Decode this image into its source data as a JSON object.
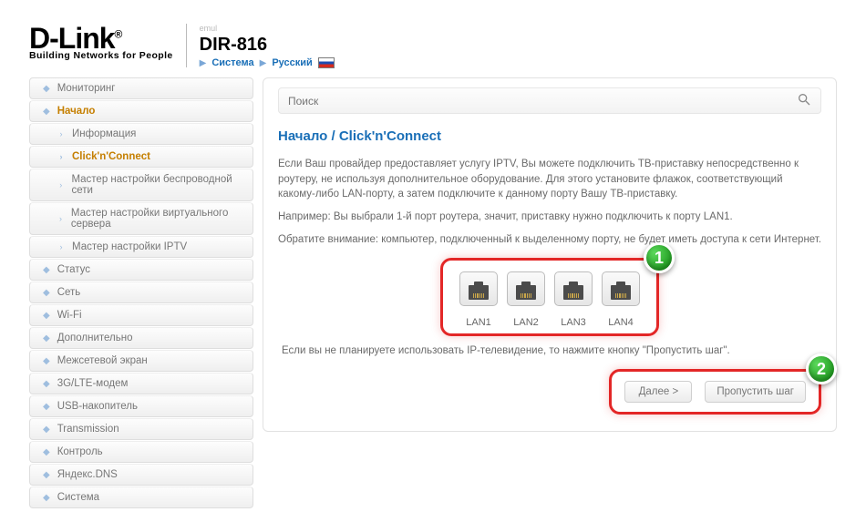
{
  "brand": {
    "title": "D-Link",
    "reg": "®",
    "tag": "Building Networks for People"
  },
  "header": {
    "emul": "emul",
    "model": "DIR-816",
    "link_system": "Система",
    "link_lang": "Русский"
  },
  "sidebar": {
    "items": [
      {
        "label": "Мониторинг"
      },
      {
        "label": "Начало"
      },
      {
        "label": "Статус"
      },
      {
        "label": "Сеть"
      },
      {
        "label": "Wi-Fi"
      },
      {
        "label": "Дополнительно"
      },
      {
        "label": "Межсетевой экран"
      },
      {
        "label": "3G/LTE-модем"
      },
      {
        "label": "USB-накопитель"
      },
      {
        "label": "Transmission"
      },
      {
        "label": "Контроль"
      },
      {
        "label": "Яндекс.DNS"
      },
      {
        "label": "Система"
      }
    ],
    "sub": [
      {
        "label": "Информация"
      },
      {
        "label": "Click'n'Connect"
      },
      {
        "label": "Мастер настройки беспроводной сети"
      },
      {
        "label": "Мастер настройки виртуального сервера"
      },
      {
        "label": "Мастер настройки IPTV"
      }
    ]
  },
  "search": {
    "placeholder": "Поиск"
  },
  "page": {
    "title": "Начало /  Click'n'Connect",
    "p1": "Если Ваш провайдер предоставляет услугу IPTV, Вы можете подключить ТВ-приставку непосредственно к роутеру, не используя дополнительное оборудование. Для этого установите флажок, соответствующий какому-либо LAN-порту, а затем подключите к данному порту Вашу ТВ-приставку.",
    "p2": "Например: Вы выбрали 1-й порт роутера, значит, приставку нужно подключить к порту LAN1.",
    "p3": "Обратите внимание: компьютер, подключенный к выделенному порту, не будет иметь доступа к сети Интернет.",
    "skip_text": "Если вы не планируете использовать IP-телевидение, то нажмите кнопку \"Пропустить шаг\"."
  },
  "ports": {
    "labels": [
      "LAN1",
      "LAN2",
      "LAN3",
      "LAN4"
    ]
  },
  "markers": {
    "m1": "1",
    "m2": "2"
  },
  "buttons": {
    "next": "Далее >",
    "skip": "Пропустить шаг"
  }
}
